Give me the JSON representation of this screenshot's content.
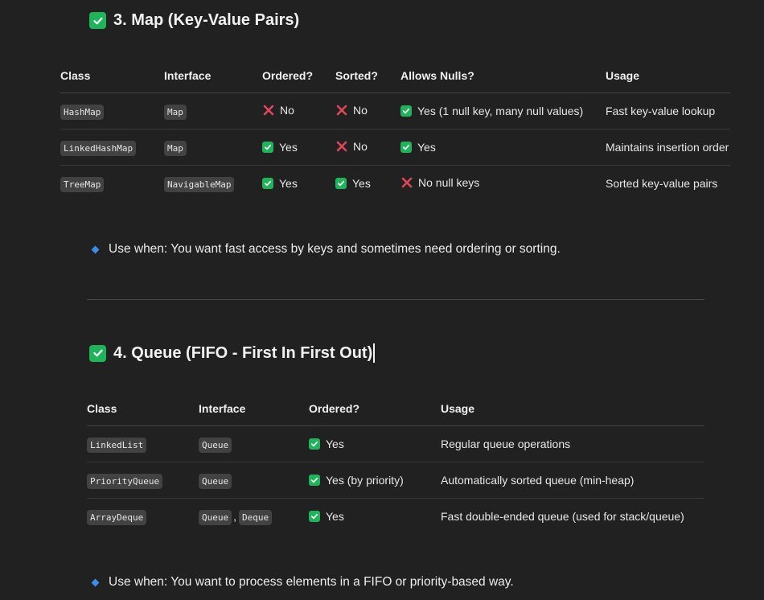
{
  "map_section": {
    "title": "3. Map (Key-Value Pairs)",
    "headers": [
      "Class",
      "Interface",
      "Ordered?",
      "Sorted?",
      "Allows Nulls?",
      "Usage"
    ],
    "rows": [
      {
        "class": "HashMap",
        "interface": "Map",
        "ordered": "No",
        "sorted": "No",
        "nulls": "Yes (1 null key, many null values)",
        "usage": "Fast key-value lookup"
      },
      {
        "class": "LinkedHashMap",
        "interface": "Map",
        "ordered": "Yes",
        "sorted": "No",
        "nulls": "Yes",
        "usage": "Maintains insertion order"
      },
      {
        "class": "TreeMap",
        "interface": "NavigableMap",
        "ordered": "Yes",
        "sorted": "Yes",
        "nulls": "No null keys",
        "usage": "Sorted key-value pairs"
      }
    ],
    "note": "Use when: You want fast access by keys and sometimes need ordering or sorting."
  },
  "queue_section": {
    "title": "4. Queue (FIFO - First In First Out)",
    "headers": [
      "Class",
      "Interface",
      "Ordered?",
      "Usage"
    ],
    "rows": [
      {
        "class": "LinkedList",
        "interface_1": "Queue",
        "ordered": "Yes",
        "usage": "Regular queue operations"
      },
      {
        "class": "PriorityQueue",
        "interface_1": "Queue",
        "ordered": "Yes (by priority)",
        "usage": "Automatically sorted queue (min-heap)"
      },
      {
        "class": "ArrayDeque",
        "interface_1": "Queue",
        "interface_sep": ",",
        "interface_2": "Deque",
        "ordered": "Yes",
        "usage": "Fast double-ended queue (used for stack/queue)"
      }
    ],
    "note": "Use when: You want to process elements in a FIFO or priority-based way."
  },
  "icons": {
    "check": "check-box-icon",
    "cross": "cross-mark-icon",
    "bullet": "blue-diamond-icon"
  },
  "colors": {
    "background": "#212121",
    "check_green": "#1fb45a",
    "cross_red": "#e0455a",
    "diamond_blue": "#3b8eea",
    "code_bg": "#424242"
  }
}
